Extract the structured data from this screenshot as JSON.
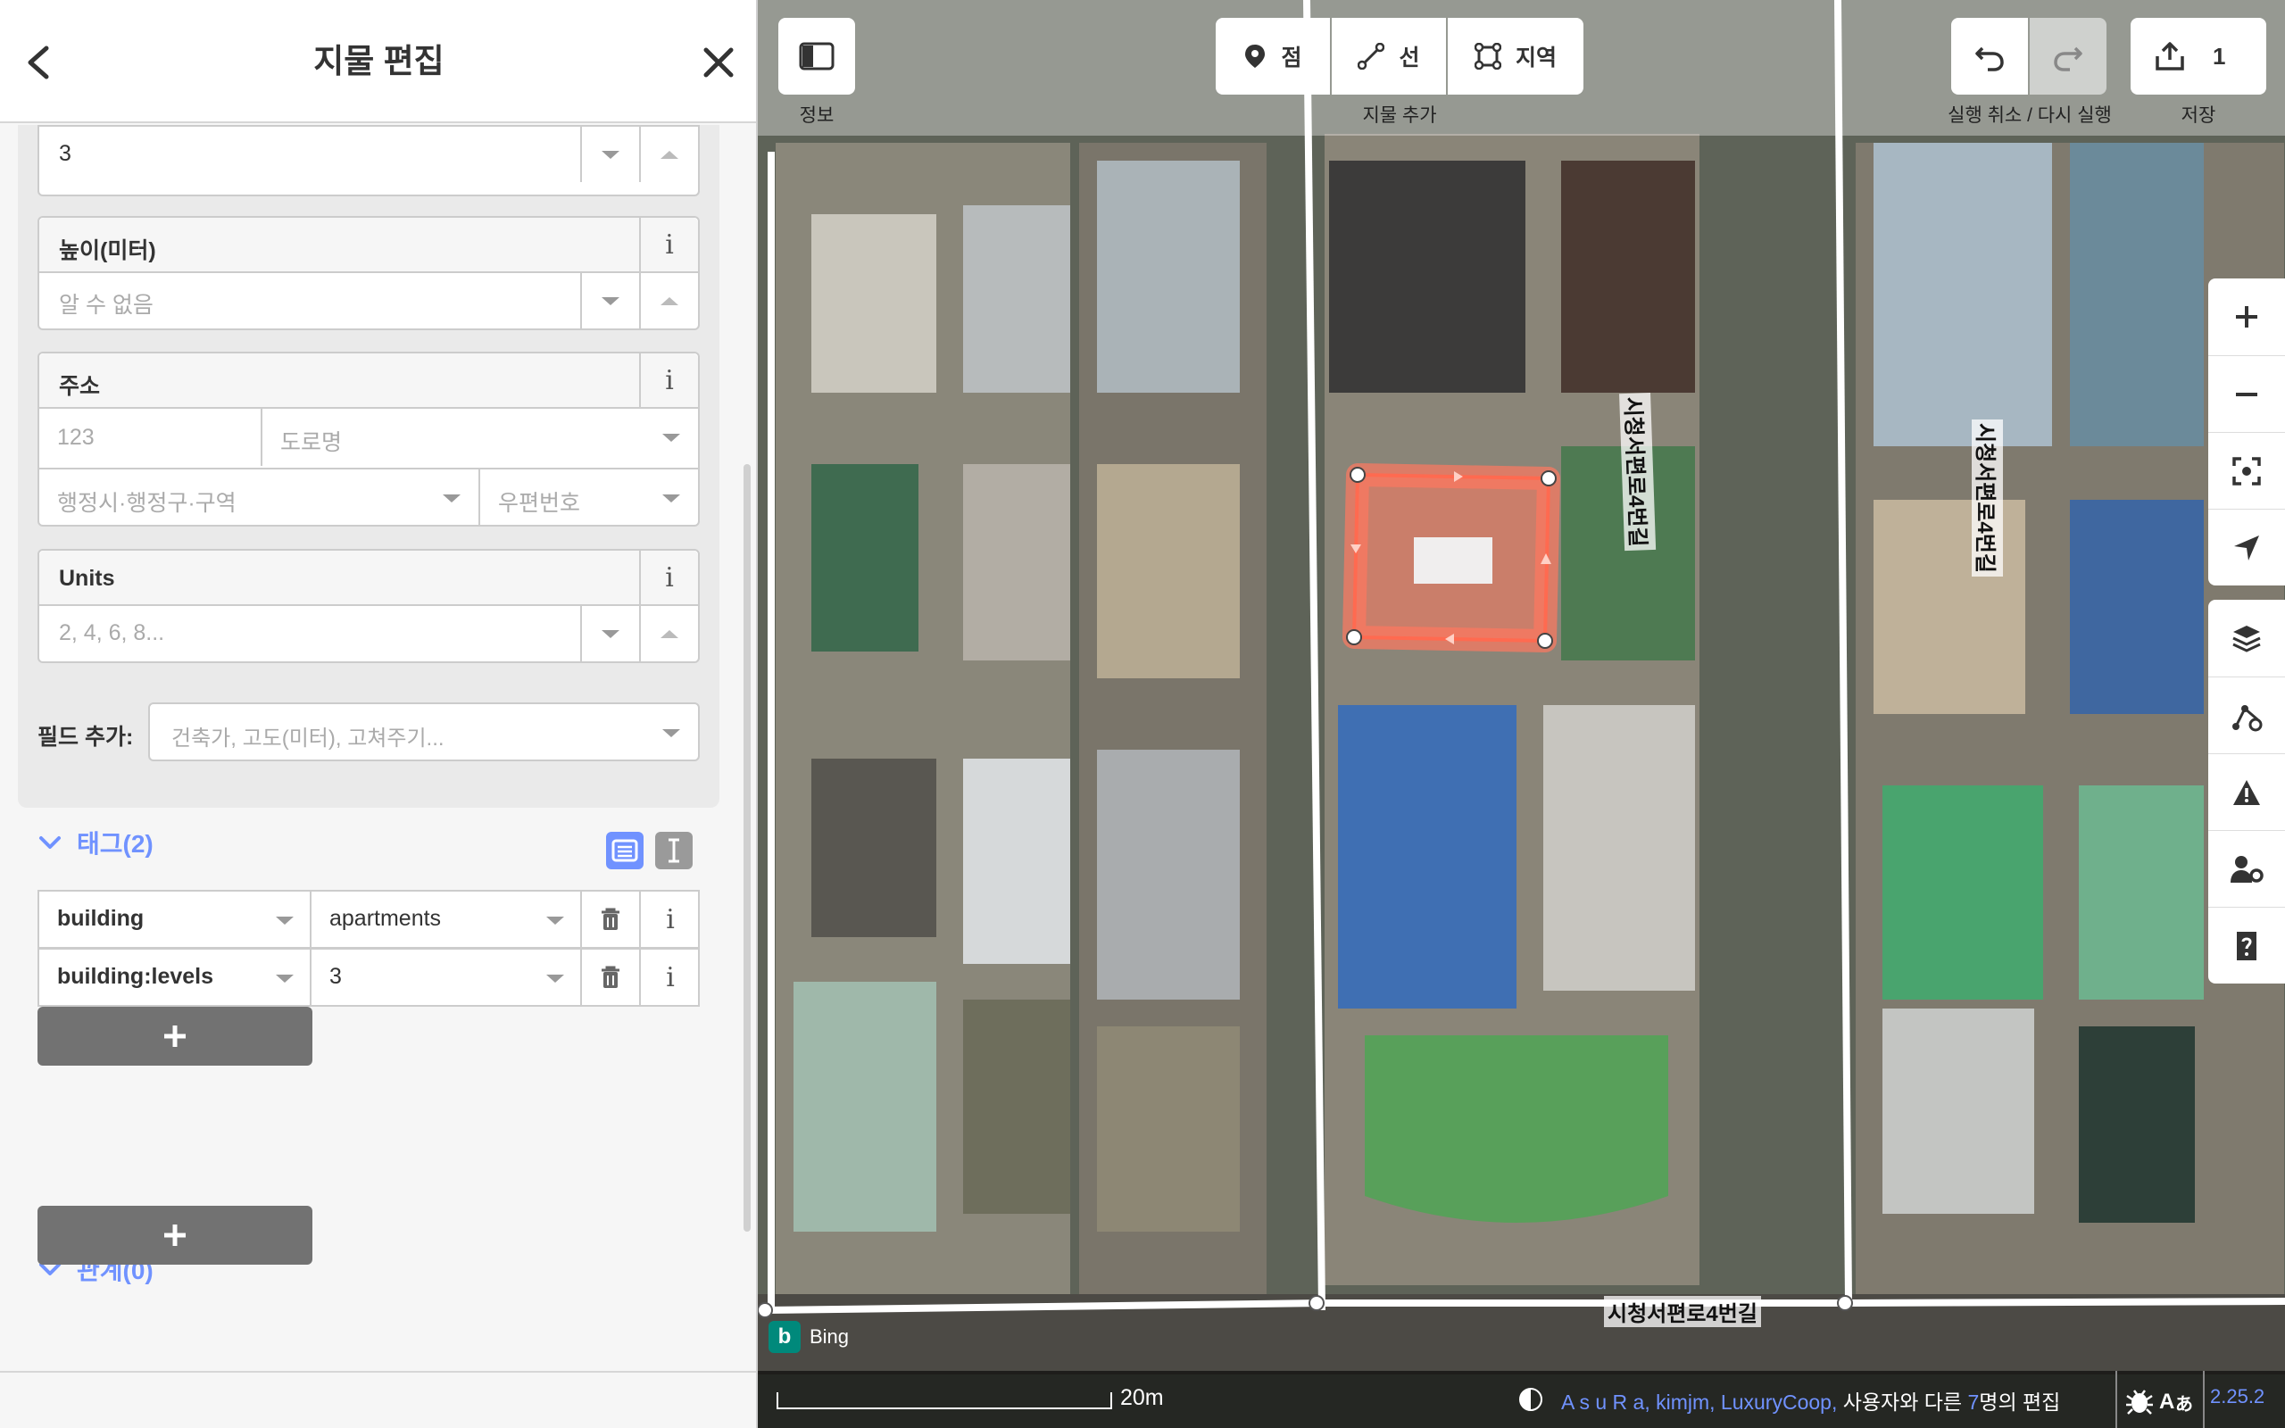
{
  "sidebar": {
    "title": "지물 편집",
    "levels_value": "3",
    "height": {
      "label": "높이(미터)",
      "placeholder": "알 수 없음"
    },
    "address": {
      "label": "주소",
      "housenumber_placeholder": "123",
      "street_placeholder": "도로명",
      "district_placeholder": "행정시·행정구·구역",
      "postcode_placeholder": "우편번호"
    },
    "units": {
      "label": "Units",
      "placeholder": "2, 4, 6, 8..."
    },
    "add_field": {
      "label": "필드 추가:",
      "placeholder": "건축가, 고도(미터), 고쳐주기..."
    },
    "tags": {
      "title": "태그(2)",
      "rows": [
        {
          "key": "building",
          "value": "apartments"
        },
        {
          "key": "building:levels",
          "value": "3"
        }
      ]
    },
    "relations": {
      "title": "관계(0)"
    },
    "info_glyph": "i",
    "plus_glyph": "+"
  },
  "map": {
    "info_caption": "정보",
    "add_caption": "지물 추가",
    "modes": [
      "점",
      "선",
      "지역"
    ],
    "undo_caption": "실행 취소 / 다시 실행",
    "save_caption": "저장",
    "save_count": "1",
    "road_names": [
      "시청서편로4번길",
      "시청서편로4번길",
      "시청서편로4번길"
    ],
    "imagery": "Bing",
    "scale": "20m",
    "attribution": {
      "contributors": "A s u R a, kimjm, LuxuryCoop,",
      "middle": " 사용자와 다른 ",
      "count": "7",
      "suffix": "명의 편집"
    },
    "version": "2.25.2",
    "right_tools": [
      "zoom-in-icon",
      "zoom-out-icon",
      "zoom-to-selection-icon",
      "geolocate-icon",
      "layers-icon",
      "map-data-icon",
      "issues-icon",
      "preferences-icon",
      "help-icon"
    ]
  },
  "colors": {
    "accent": "#7092ff",
    "selection": "#ff6a50"
  }
}
